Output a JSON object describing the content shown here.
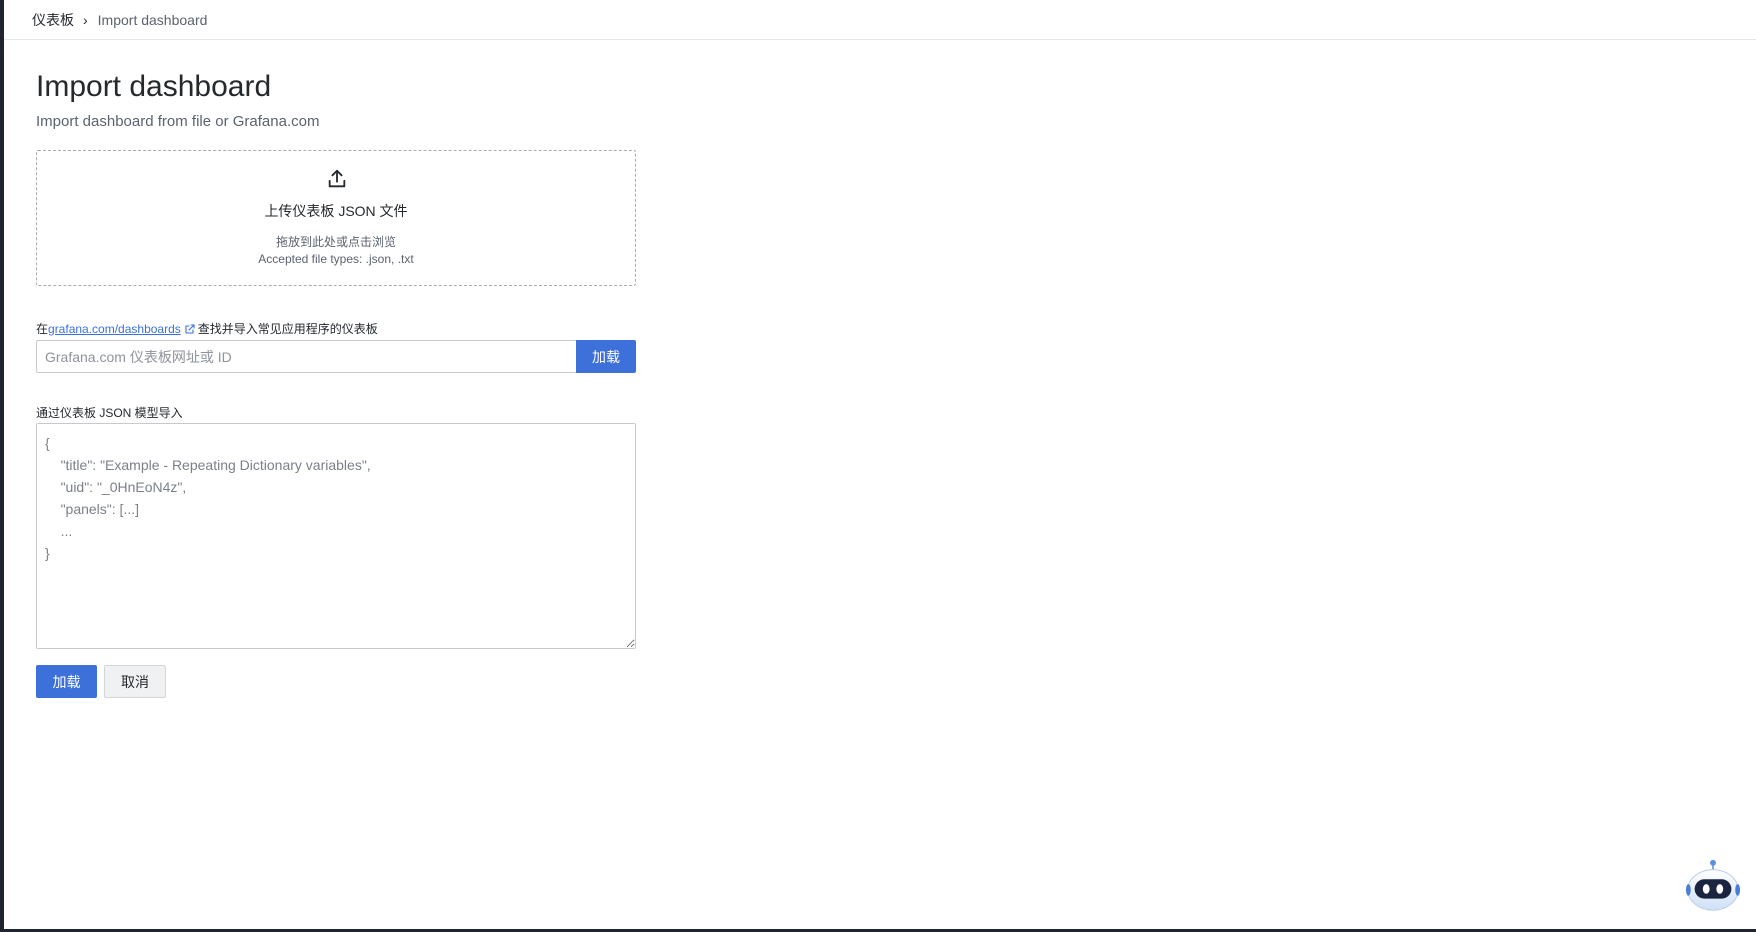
{
  "breadcrumb": {
    "root": "仪表板",
    "separator": "›",
    "current": "Import dashboard"
  },
  "page": {
    "title": "Import dashboard",
    "subtitle": "Import dashboard from file or Grafana.com"
  },
  "upload": {
    "icon": "upload-icon",
    "title": "上传仪表板 JSON 文件",
    "hint": "拖放到此处或点击浏览",
    "accepted_types": "Accepted file types: .json, .txt"
  },
  "grafana_com": {
    "label_prefix": "在",
    "link_text": "grafana.com/dashboards",
    "link_icon": "external-link-icon",
    "label_suffix": "查找并导入常见应用程序的仪表板",
    "input_placeholder": "Grafana.com 仪表板网址或 ID",
    "input_value": "",
    "load_label": "加载"
  },
  "json_model": {
    "label": "通过仪表板 JSON 模型导入",
    "placeholder": "{\n    \"title\": \"Example - Repeating Dictionary variables\",\n    \"uid\": \"_0HnEoN4z\",\n    \"panels\": [...]\n    ...\n}",
    "value": ""
  },
  "actions": {
    "load_label": "加载",
    "cancel_label": "取消"
  },
  "assistant": {
    "icon": "robot-assistant-icon"
  },
  "colors": {
    "primary": "#3d71d9",
    "link": "#3871dc",
    "text": "#24292e",
    "muted": "#5b6270",
    "border": "#c7c9cd",
    "frame": "#1f2430"
  }
}
